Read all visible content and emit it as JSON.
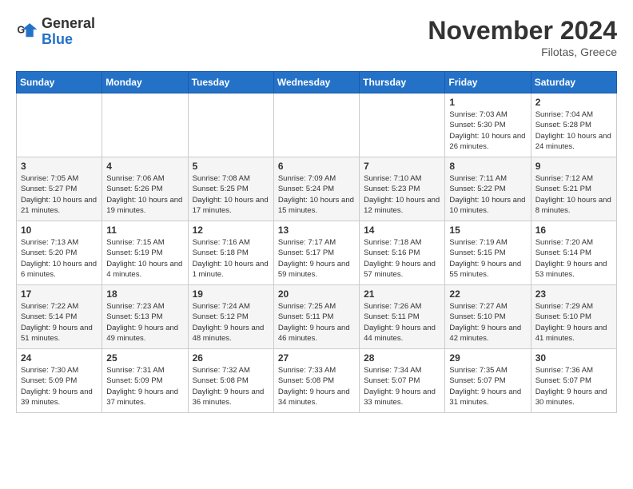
{
  "logo": {
    "text_general": "General",
    "text_blue": "Blue"
  },
  "header": {
    "month": "November 2024",
    "location": "Filotas, Greece"
  },
  "weekdays": [
    "Sunday",
    "Monday",
    "Tuesday",
    "Wednesday",
    "Thursday",
    "Friday",
    "Saturday"
  ],
  "weeks": [
    [
      {
        "day": "",
        "info": ""
      },
      {
        "day": "",
        "info": ""
      },
      {
        "day": "",
        "info": ""
      },
      {
        "day": "",
        "info": ""
      },
      {
        "day": "",
        "info": ""
      },
      {
        "day": "1",
        "info": "Sunrise: 7:03 AM\nSunset: 5:30 PM\nDaylight: 10 hours and 26 minutes."
      },
      {
        "day": "2",
        "info": "Sunrise: 7:04 AM\nSunset: 5:28 PM\nDaylight: 10 hours and 24 minutes."
      }
    ],
    [
      {
        "day": "3",
        "info": "Sunrise: 7:05 AM\nSunset: 5:27 PM\nDaylight: 10 hours and 21 minutes."
      },
      {
        "day": "4",
        "info": "Sunrise: 7:06 AM\nSunset: 5:26 PM\nDaylight: 10 hours and 19 minutes."
      },
      {
        "day": "5",
        "info": "Sunrise: 7:08 AM\nSunset: 5:25 PM\nDaylight: 10 hours and 17 minutes."
      },
      {
        "day": "6",
        "info": "Sunrise: 7:09 AM\nSunset: 5:24 PM\nDaylight: 10 hours and 15 minutes."
      },
      {
        "day": "7",
        "info": "Sunrise: 7:10 AM\nSunset: 5:23 PM\nDaylight: 10 hours and 12 minutes."
      },
      {
        "day": "8",
        "info": "Sunrise: 7:11 AM\nSunset: 5:22 PM\nDaylight: 10 hours and 10 minutes."
      },
      {
        "day": "9",
        "info": "Sunrise: 7:12 AM\nSunset: 5:21 PM\nDaylight: 10 hours and 8 minutes."
      }
    ],
    [
      {
        "day": "10",
        "info": "Sunrise: 7:13 AM\nSunset: 5:20 PM\nDaylight: 10 hours and 6 minutes."
      },
      {
        "day": "11",
        "info": "Sunrise: 7:15 AM\nSunset: 5:19 PM\nDaylight: 10 hours and 4 minutes."
      },
      {
        "day": "12",
        "info": "Sunrise: 7:16 AM\nSunset: 5:18 PM\nDaylight: 10 hours and 1 minute."
      },
      {
        "day": "13",
        "info": "Sunrise: 7:17 AM\nSunset: 5:17 PM\nDaylight: 9 hours and 59 minutes."
      },
      {
        "day": "14",
        "info": "Sunrise: 7:18 AM\nSunset: 5:16 PM\nDaylight: 9 hours and 57 minutes."
      },
      {
        "day": "15",
        "info": "Sunrise: 7:19 AM\nSunset: 5:15 PM\nDaylight: 9 hours and 55 minutes."
      },
      {
        "day": "16",
        "info": "Sunrise: 7:20 AM\nSunset: 5:14 PM\nDaylight: 9 hours and 53 minutes."
      }
    ],
    [
      {
        "day": "17",
        "info": "Sunrise: 7:22 AM\nSunset: 5:14 PM\nDaylight: 9 hours and 51 minutes."
      },
      {
        "day": "18",
        "info": "Sunrise: 7:23 AM\nSunset: 5:13 PM\nDaylight: 9 hours and 49 minutes."
      },
      {
        "day": "19",
        "info": "Sunrise: 7:24 AM\nSunset: 5:12 PM\nDaylight: 9 hours and 48 minutes."
      },
      {
        "day": "20",
        "info": "Sunrise: 7:25 AM\nSunset: 5:11 PM\nDaylight: 9 hours and 46 minutes."
      },
      {
        "day": "21",
        "info": "Sunrise: 7:26 AM\nSunset: 5:11 PM\nDaylight: 9 hours and 44 minutes."
      },
      {
        "day": "22",
        "info": "Sunrise: 7:27 AM\nSunset: 5:10 PM\nDaylight: 9 hours and 42 minutes."
      },
      {
        "day": "23",
        "info": "Sunrise: 7:29 AM\nSunset: 5:10 PM\nDaylight: 9 hours and 41 minutes."
      }
    ],
    [
      {
        "day": "24",
        "info": "Sunrise: 7:30 AM\nSunset: 5:09 PM\nDaylight: 9 hours and 39 minutes."
      },
      {
        "day": "25",
        "info": "Sunrise: 7:31 AM\nSunset: 5:09 PM\nDaylight: 9 hours and 37 minutes."
      },
      {
        "day": "26",
        "info": "Sunrise: 7:32 AM\nSunset: 5:08 PM\nDaylight: 9 hours and 36 minutes."
      },
      {
        "day": "27",
        "info": "Sunrise: 7:33 AM\nSunset: 5:08 PM\nDaylight: 9 hours and 34 minutes."
      },
      {
        "day": "28",
        "info": "Sunrise: 7:34 AM\nSunset: 5:07 PM\nDaylight: 9 hours and 33 minutes."
      },
      {
        "day": "29",
        "info": "Sunrise: 7:35 AM\nSunset: 5:07 PM\nDaylight: 9 hours and 31 minutes."
      },
      {
        "day": "30",
        "info": "Sunrise: 7:36 AM\nSunset: 5:07 PM\nDaylight: 9 hours and 30 minutes."
      }
    ]
  ]
}
